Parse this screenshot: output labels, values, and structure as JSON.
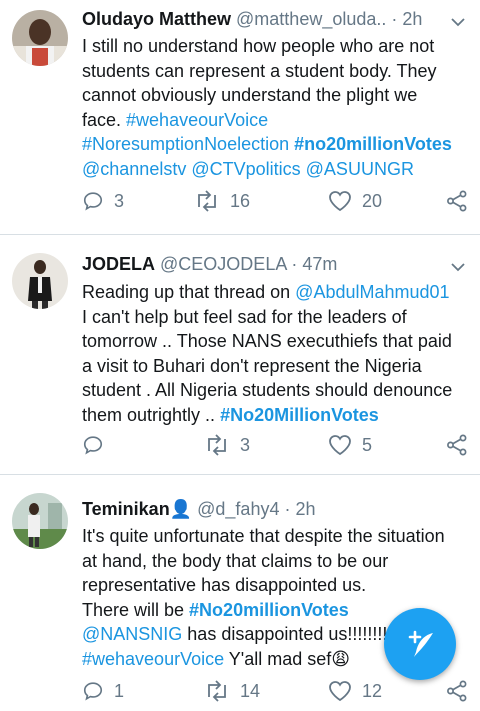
{
  "colors": {
    "link": "#1b95e0",
    "muted": "#657786",
    "fab": "#1da1f2"
  },
  "tweets": [
    {
      "name": "Oludayo Matthew",
      "handle": "@matthew_oluda..",
      "time": "· 2h",
      "lines": [
        [
          {
            "t": "I still no understand how people who are not"
          }
        ],
        [
          {
            "t": "students can represent a student body. They"
          }
        ],
        [
          {
            "t": "cannot obviously understand the plight we"
          }
        ],
        [
          {
            "t": "face.  "
          },
          {
            "t": "#wehaveourVoice",
            "link": true
          }
        ],
        [
          {
            "t": "#NoresumptionNoelection",
            "link": true
          },
          {
            "t": " "
          },
          {
            "t": "#no20millionVotes",
            "link": true,
            "bold": true
          }
        ],
        [
          {
            "t": "@channelstv",
            "link": true
          },
          {
            "t": " "
          },
          {
            "t": "@CTVpolitics",
            "link": true
          },
          {
            "t": " "
          },
          {
            "t": "@ASUUNGR",
            "link": true
          }
        ]
      ],
      "replies": "3",
      "retweets": "16",
      "likes": "20"
    },
    {
      "name": "JODELA",
      "handle": "@CEOJODELA",
      "time": "· 47m",
      "lines": [
        [
          {
            "t": "Reading up that  thread on "
          },
          {
            "t": "@AbdulMahmud01",
            "link": true
          }
        ],
        [
          {
            "t": "I can't help but feel sad for the leaders of"
          }
        ],
        [
          {
            "t": "tomorrow .. Those NANS executhiefs that paid"
          }
        ],
        [
          {
            "t": "a visit to Buhari don't represent the Nigeria"
          }
        ],
        [
          {
            "t": "student . All Nigeria students should denounce"
          }
        ],
        [
          {
            "t": "them outrightly .. "
          },
          {
            "t": "#No20MillionVotes",
            "link": true,
            "bold": true
          }
        ]
      ],
      "replies": "",
      "retweets": "3",
      "likes": "5"
    },
    {
      "name": "Teminikan",
      "name_suffix": "👤",
      "handle": "@d_fahy4",
      "time": "· 2h",
      "lines": [
        [
          {
            "t": "It's quite unfortunate that despite the situation"
          }
        ],
        [
          {
            "t": "at hand, the body that claims to be our"
          }
        ],
        [
          {
            "t": "representative has disappointed us."
          }
        ],
        [
          {
            "t": "There will be "
          },
          {
            "t": "#No20millionVotes",
            "link": true,
            "bold": true
          }
        ],
        [
          {
            "t": "@NANSNIG",
            "link": true
          },
          {
            "t": " has disappointed us!!!!!!!!"
          }
        ],
        [
          {
            "t": "#wehaveourVoice",
            "link": true
          },
          {
            "t": " Y'all mad sef😩"
          }
        ]
      ],
      "replies": "1",
      "retweets": "14",
      "likes": "12"
    }
  ],
  "icons": {
    "reply": "reply-icon",
    "retweet": "retweet-icon",
    "like": "heart-icon",
    "share": "share-icon",
    "chevron": "chevron-down-icon",
    "compose": "compose-tweet-icon"
  }
}
